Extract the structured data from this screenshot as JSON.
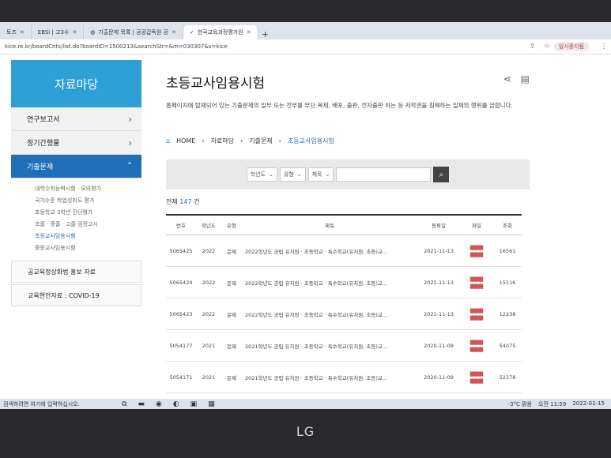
{
  "browser": {
    "tabs": [
      {
        "label": "토즈",
        "active": false
      },
      {
        "label": "EBSi | 고3수",
        "active": false
      },
      {
        "label": "기출문제 목록 | 공공갑독원 공",
        "active": false
      },
      {
        "label": "한국교육과정평가원",
        "active": true
      }
    ],
    "url": "kice.re.kr/boardCnts/list.do?boardID=1500213&searchStr=&m=030307&s=kice",
    "user_label": "일시중지됨"
  },
  "sidebar": {
    "heading": "자료마당",
    "menu": [
      {
        "label": "연구보고서"
      },
      {
        "label": "정기간행물"
      },
      {
        "label": "기출문제"
      }
    ],
    "submenu": [
      "대학수학능력시험 · 모의평가",
      "국가수준 학업성취도 평가",
      "초등학교 3학년 진단평가",
      "초졸 · 중졸 · 고졸 검정고시",
      "초등교사임용시험",
      "중등교사임용시험"
    ],
    "boxes": [
      "공교육정상화법 홍보 자료",
      "교육현안자료 : COVID-19"
    ]
  },
  "main": {
    "title": "초등교사임용시험",
    "description": "홈페이지에 탑재되어 있는 기출문제의 일부 또는 전부를 무단 복제, 배포, 출판, 전자출판 하는 등 저작권을 침해하는 일체의 행위를 금합니다.",
    "breadcrumb": [
      "HOME",
      "자료마당",
      "기출문제",
      "초등교사임용시험"
    ],
    "filters": {
      "year": "학년도",
      "type": "유형",
      "field": "제목"
    },
    "total_prefix": "전체",
    "total_count": "147",
    "total_suffix": "건",
    "columns": [
      "번호",
      "학년도",
      "유형",
      "제목",
      "등록일",
      "파일",
      "조회"
    ],
    "rows": [
      {
        "no": "5065425",
        "year": "2022",
        "type": "문제",
        "title": "2022학년도 공립 유치원 · 초등학교 · 특수학교(유치원, 초등)교...",
        "date": "2021-11-13",
        "views": "16561"
      },
      {
        "no": "5065424",
        "year": "2022",
        "type": "문제",
        "title": "2022학년도 공립 유치원 · 초등학교 · 특수학교(유치원, 초등)교...",
        "date": "2021-11-13",
        "views": "15116"
      },
      {
        "no": "5065423",
        "year": "2022",
        "type": "문제",
        "title": "2022학년도 공립 유치원 · 초등학교 · 특수학교(유치원, 초등)교...",
        "date": "2021-11-13",
        "views": "12238"
      },
      {
        "no": "5054177",
        "year": "2021",
        "type": "문제",
        "title": "2021학년도 공립 유치원 · 초등학교 · 특수학교(유치원, 초등)교...",
        "date": "2020-11-09",
        "views": "54075"
      },
      {
        "no": "5054171",
        "year": "2021",
        "type": "문제",
        "title": "2021학년도 공립 유치원 · 초등학교 · 특수학교(유치원, 초등)교...",
        "date": "2020-11-09",
        "views": "52378"
      }
    ]
  },
  "taskbar": {
    "search_text": "검색하려면 여기에 입력하십시오.",
    "weather": "-3°C 맑음",
    "time": "오전 11:59",
    "date": "2022-01-15"
  },
  "bezel_logo": "LG",
  "colors": {
    "accent": "#1f6fb8",
    "sidebar_head": "#2ea0d6"
  }
}
